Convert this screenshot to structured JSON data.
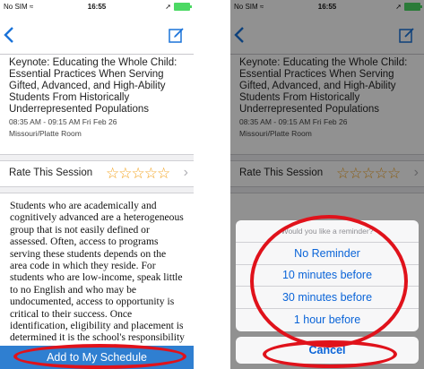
{
  "status": {
    "carrier": "No SIM",
    "time": "16:55"
  },
  "session": {
    "title": "Keynote: Educating the Whole Child: Essential Practices When Serving Gifted, Advanced, and High-Ability Students From Historically Underrepresented Populations",
    "time": "08:35 AM - 09:15 AM Fri Feb 26",
    "room": "Missouri/Platte Room"
  },
  "rating": {
    "label": "Rate This Session",
    "stars": "☆☆☆☆☆",
    "chevron": "›"
  },
  "description": "Students who are academically and cognitively advanced are a heterogeneous group that is not easily defined or assessed. Often, access to programs serving these students depends on the area code in which they reside. For students who are low-income, speak little to no English and who may be undocumented, access to opportunity is critical to their success. Once identification, eligibility and placement is determined it is the school's responsibility to ensure that the needs of the whole child will",
  "add_button": "Add to My Schedule",
  "reminder_sheet": {
    "prompt": "Would you like a reminder?",
    "options": [
      "No Reminder",
      "10 minutes before",
      "30 minutes before",
      "1 hour before"
    ],
    "cancel": "Cancel"
  },
  "colors": {
    "accent": "#2f7fd1",
    "highlight": "#e0121b",
    "star": "#f3a31f"
  }
}
